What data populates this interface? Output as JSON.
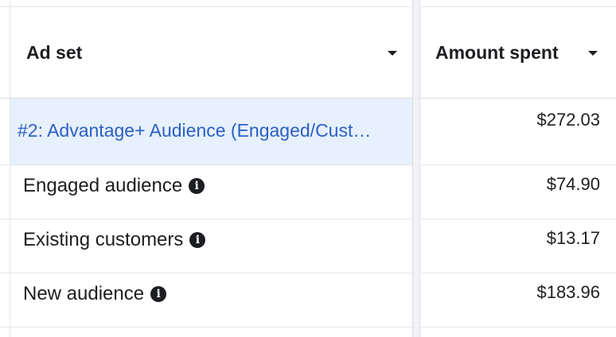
{
  "header": {
    "ad_set_label": "Ad set",
    "amount_spent_label": "Amount spent"
  },
  "rows": [
    {
      "name": "#2: Advantage+ Audience (Engaged/Cust…",
      "amount": "$272.03",
      "is_link": true,
      "info_icon": false
    },
    {
      "name": "Engaged audience",
      "amount": "$74.90",
      "is_link": false,
      "info_icon": true
    },
    {
      "name": "Existing customers",
      "amount": "$13.17",
      "is_link": false,
      "info_icon": true
    },
    {
      "name": "New audience",
      "amount": "$183.96",
      "is_link": false,
      "info_icon": true
    }
  ],
  "colors": {
    "link": "#2b5fc4",
    "highlight_row": "#e7f0fd",
    "border": "#e4e6eb",
    "header_bg": "#ffffff"
  },
  "icons": {
    "sort_caret": "caret-down-icon",
    "info": "info-icon"
  }
}
